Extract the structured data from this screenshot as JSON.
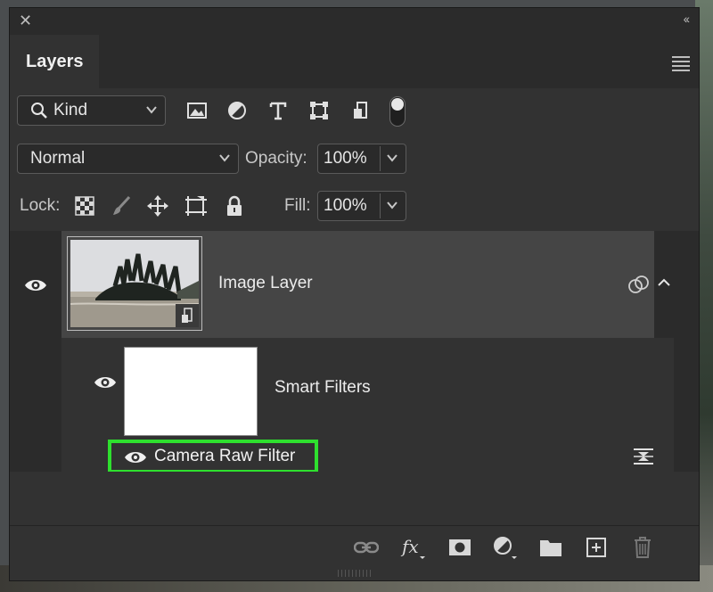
{
  "panel": {
    "tab_title": "Layers"
  },
  "filter": {
    "kind_label": "Kind"
  },
  "blend": {
    "mode": "Normal",
    "opacity_label": "Opacity:",
    "opacity_value": "100%"
  },
  "lock": {
    "label": "Lock:",
    "fill_label": "Fill:",
    "fill_value": "100%"
  },
  "layers": {
    "image_layer_name": "Image Layer",
    "smart_filters_name": "Smart Filters",
    "filter_name": "Camera Raw Filter"
  },
  "colors": {
    "highlight": "#2ee02e",
    "panel_bg": "#323232"
  }
}
